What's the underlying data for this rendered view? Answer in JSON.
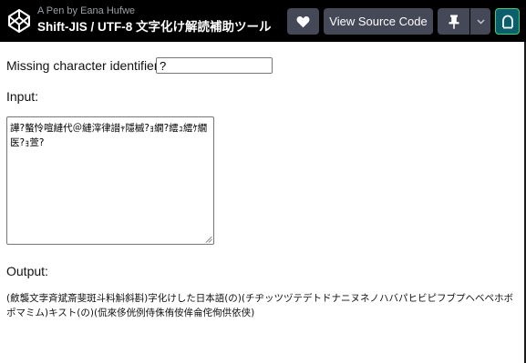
{
  "header": {
    "pen_by": "A Pen by Eana Hufwe",
    "pen_title": "Shift-JIS / UTF-8 文字化け解読補助ツール",
    "buttons": {
      "heart_icon": "heart-icon",
      "view_source_label": "View Source Code",
      "pin_icon": "pin-icon",
      "pin_menu_icon": "chevron-down-icon",
      "user_icon": "user-icon"
    },
    "colors": {
      "bar_bg": "#000000",
      "button_bg": "#444857",
      "user_button_bg": "#0b5f6c",
      "user_button_border": "#47cf73"
    }
  },
  "form": {
    "missing_label": "Missing character identifier:",
    "missing_value": "?",
    "input_label": "Input:",
    "input_value": "譁?螯怜喧縺代＠縺滓律譛ｬ隱槭?ｮ繝?繧ｭ繧ｹ繝医?ｮ萱?",
    "output_label": "Output:",
    "output_text": "(斂襲文孛斉斌斎斐斑斗料斛斜斟)字化けした日本語(の)(チヂッツヅテデトドナニヌネノハバパヒビピフブプヘベペホボポマミム)キスト(の)(侃來侈侊例侍侏侑侒侔侖侘侚供依侠)"
  }
}
